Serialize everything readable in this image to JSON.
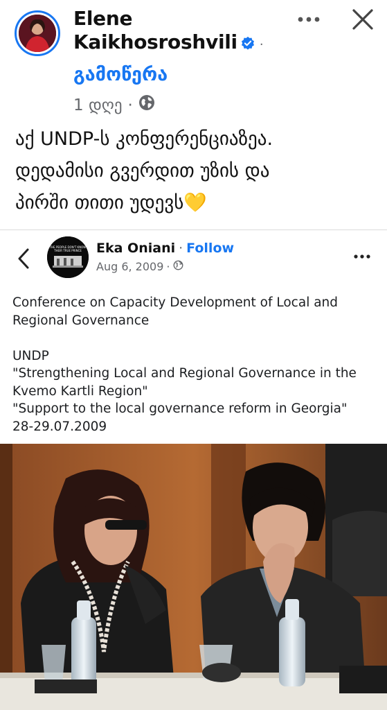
{
  "post": {
    "author": "Elene Kaikhosroshvili",
    "author_line1": "Elene",
    "author_line2": "Kaikhosroshvili",
    "subscribe_label": "გამოწერა",
    "time_ago": "1 დღე",
    "meta_sep": "·",
    "text_lines": [
      "აქ UNDP-ს კონფერენციაზეა.",
      "დედამისი გვერდით უზის და",
      "პირში თითი უდევს💛"
    ],
    "icons": {
      "verified": "verified-badge-icon",
      "privacy": "globe-icon",
      "more": "more-options-icon",
      "close": "close-icon"
    }
  },
  "shared_post": {
    "author": "Eka Oniani",
    "follow_label": "Follow",
    "date": "Aug 6, 2009",
    "sep": "·",
    "avatar_text_line1": "THE PEOPLE DON'T KNOW",
    "avatar_text_line2": "THEIR TRUE PRINCE",
    "text_blocks": [
      [
        "Conference on Capacity Development of Local and",
        "Regional Governance"
      ],
      [
        "UNDP",
        "\"Strengthening Local and Regional Governance in the",
        "Kvemo Kartli Region\"",
        "\"Support to the local governance reform in Georgia\"",
        "28-29.07.2009"
      ]
    ],
    "icons": {
      "back": "chevron-left-icon",
      "privacy": "globe-icon",
      "more": "more-options-icon"
    }
  },
  "colors": {
    "accent": "#1877f2",
    "text": "#111111",
    "secondary": "#65676b"
  }
}
